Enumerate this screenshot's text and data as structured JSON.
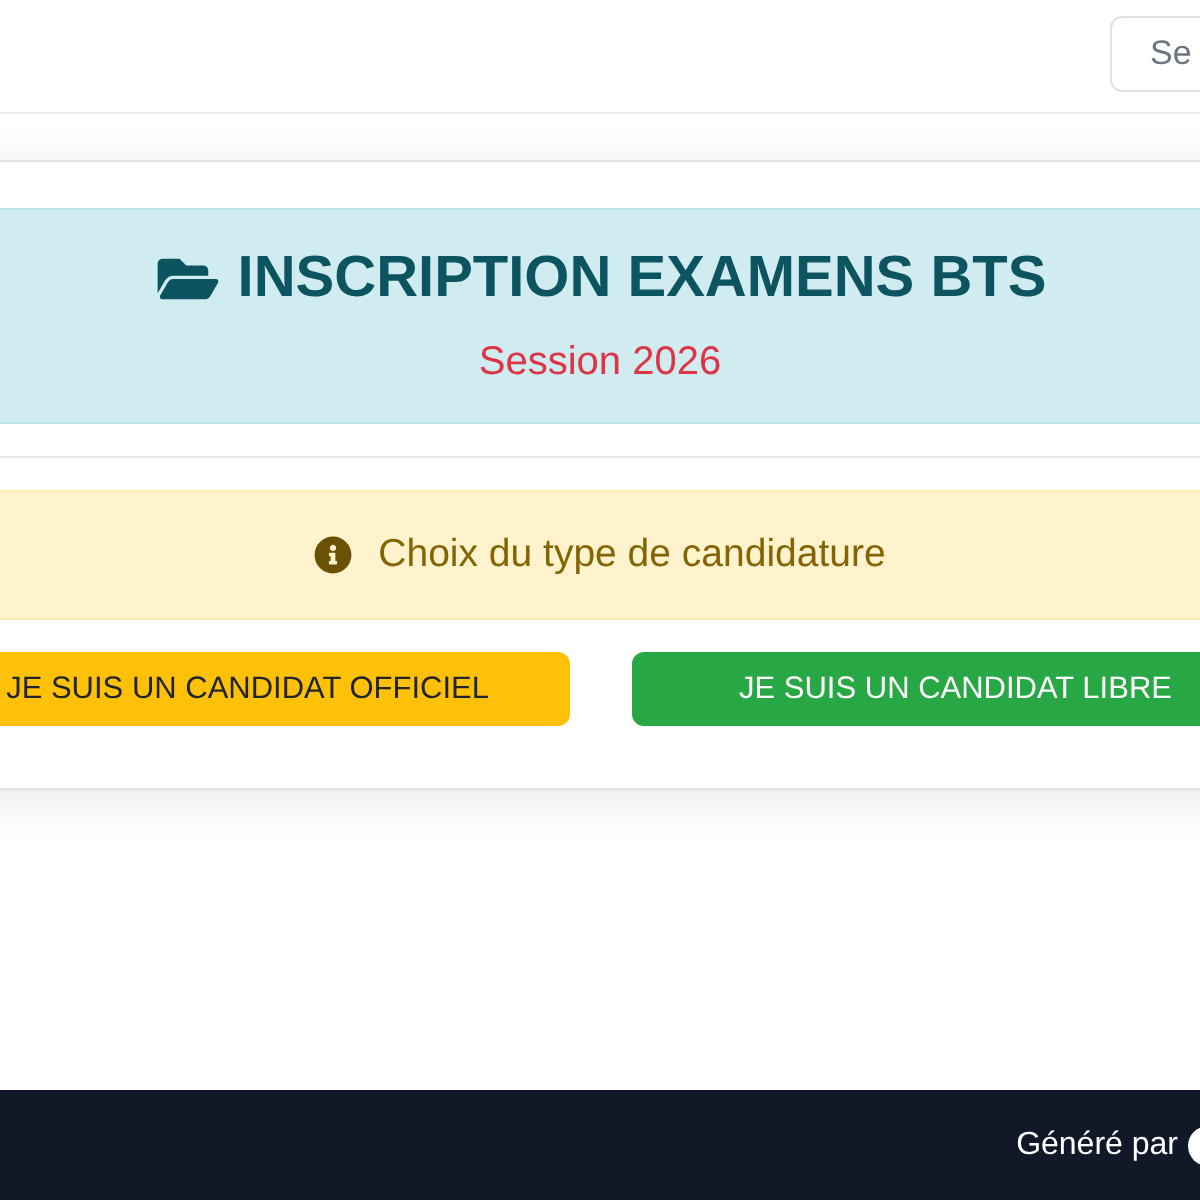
{
  "header": {
    "button": "Se"
  },
  "card": {
    "banner": {
      "title": "INSCRIPTION EXAMENS BTS",
      "subtitle": "Session 2026"
    },
    "notice": {
      "text": "Choix du type de candidature"
    },
    "choices": [
      {
        "label": "JE SUIS UN CANDIDAT OFFICIEL",
        "kind": "warning"
      },
      {
        "label": "JE SUIS UN CANDIDAT LIBRE",
        "kind": "success"
      }
    ]
  },
  "footer": {
    "text": "Généré par"
  }
}
